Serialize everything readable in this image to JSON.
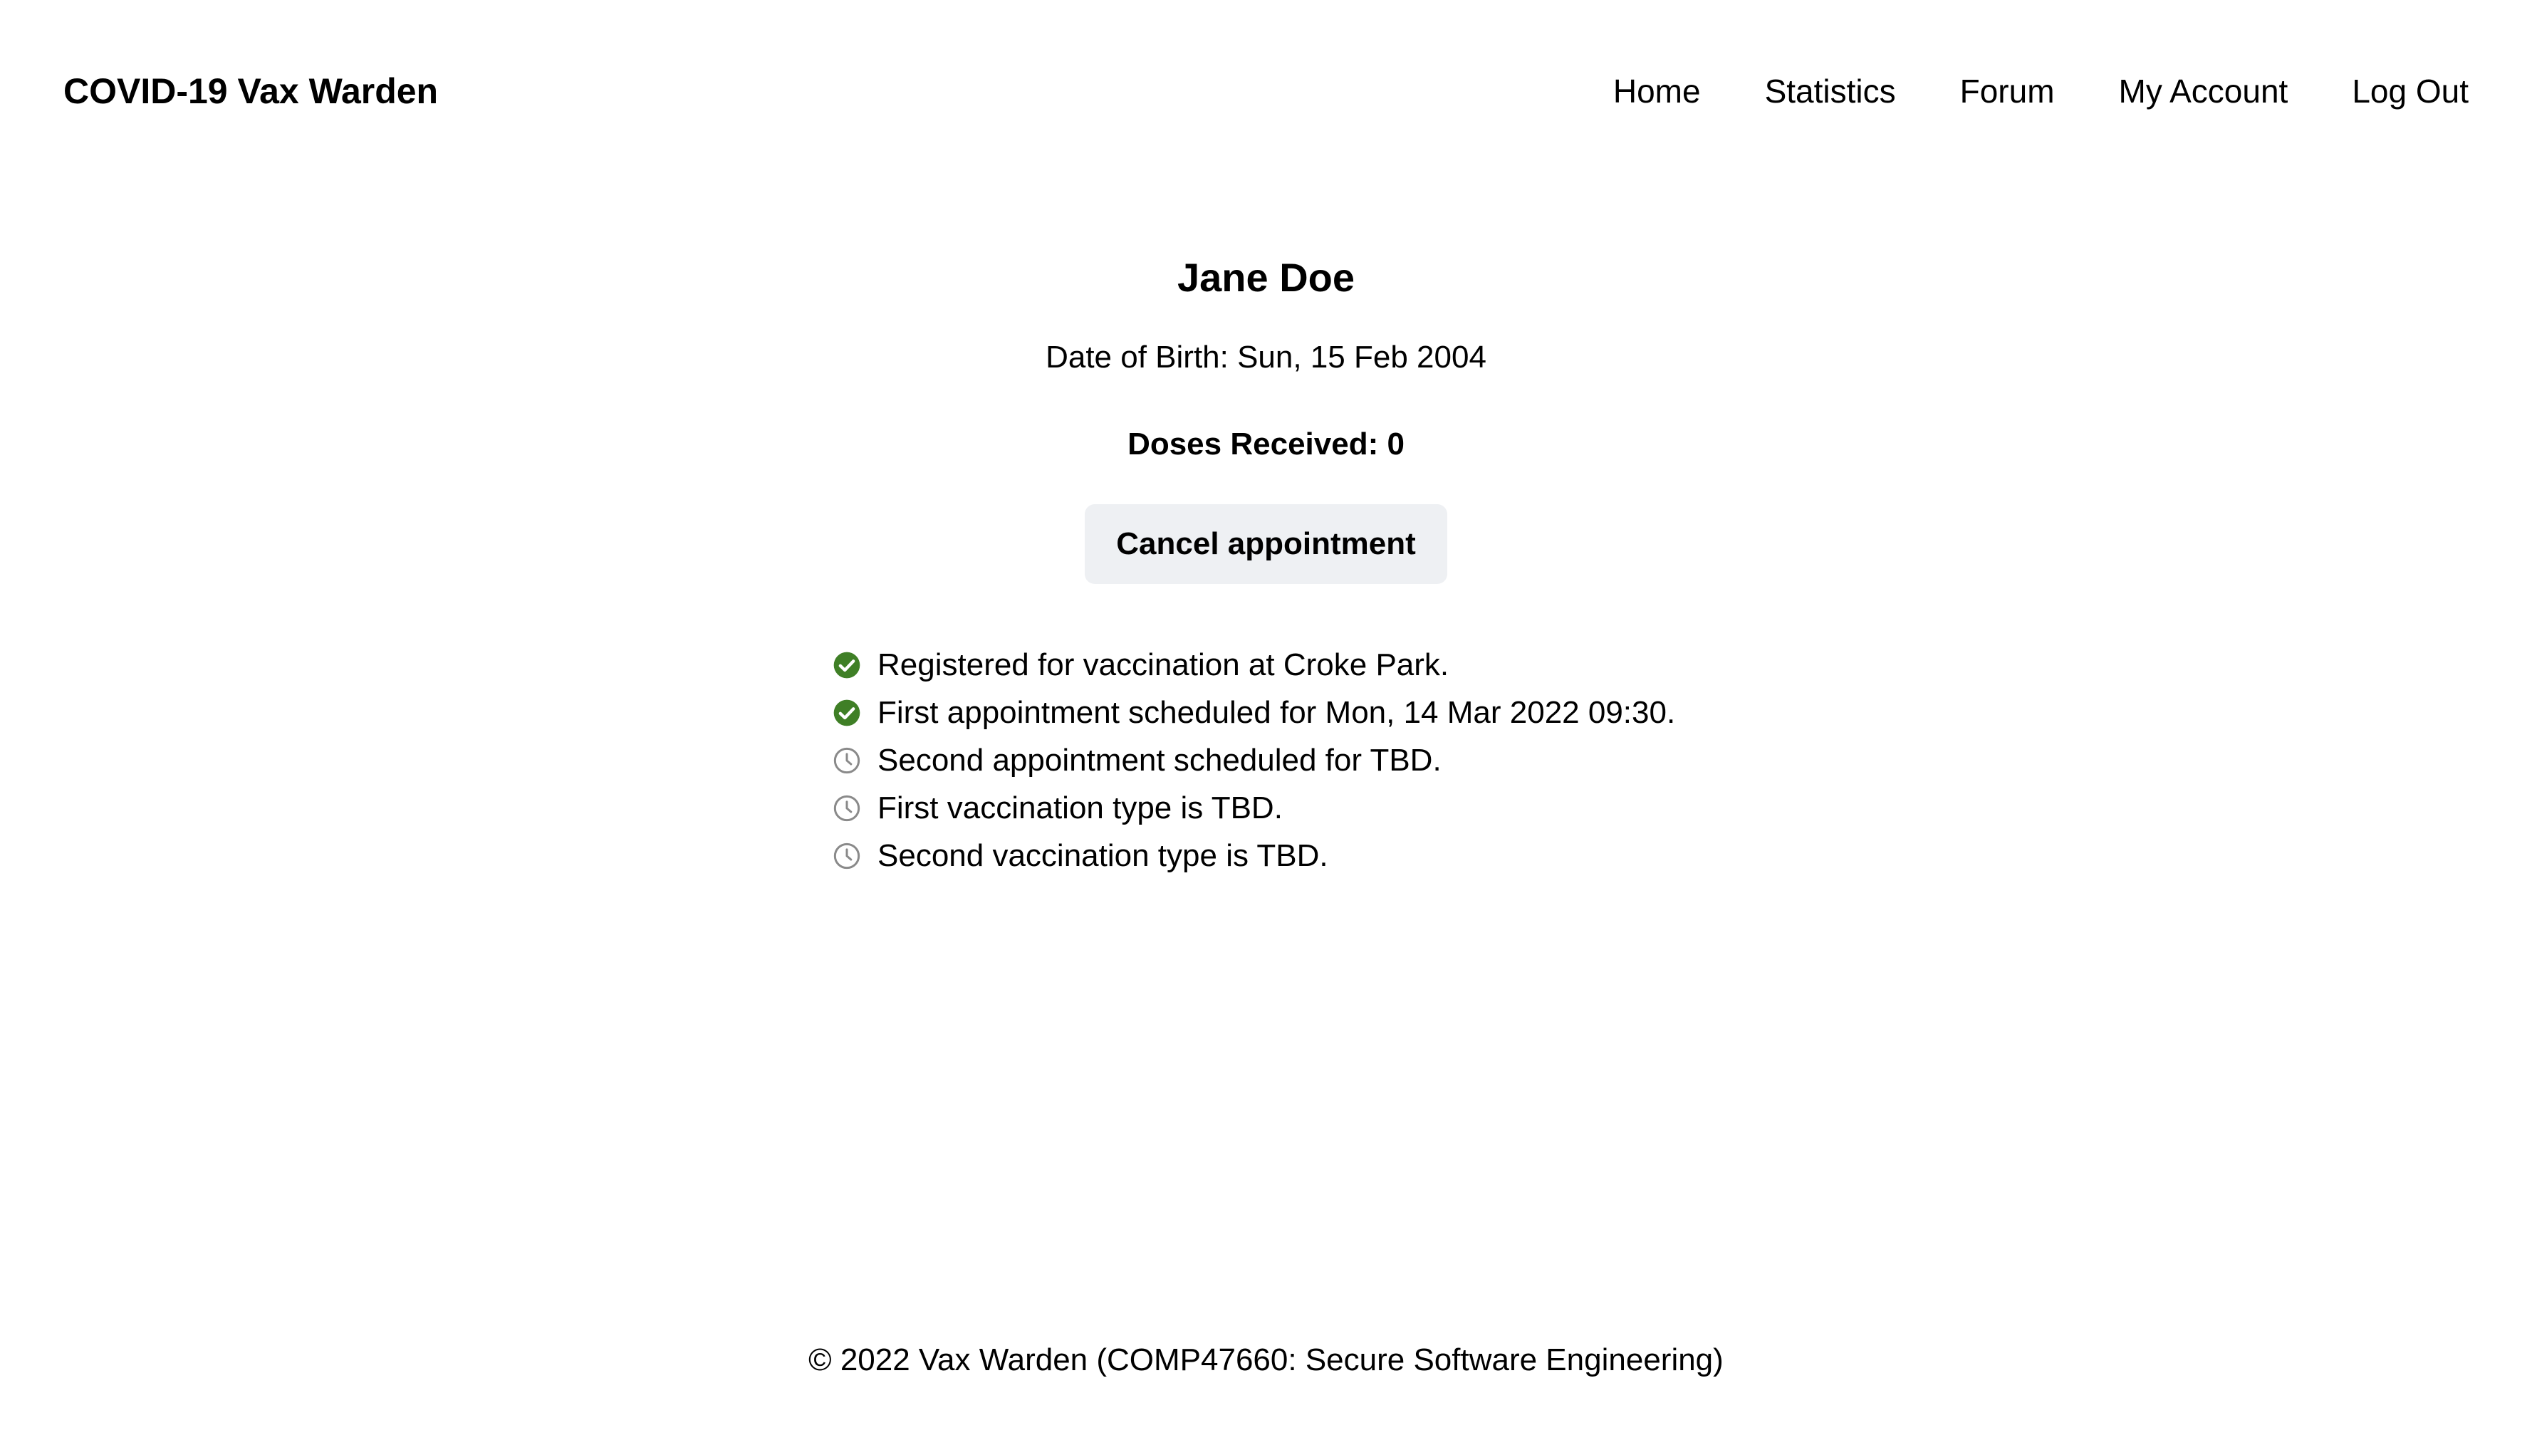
{
  "header": {
    "brand": "COVID-19 Vax Warden",
    "nav": {
      "home": "Home",
      "statistics": "Statistics",
      "forum": "Forum",
      "account": "My Account",
      "logout": "Log Out"
    }
  },
  "profile": {
    "name": "Jane Doe",
    "dob": "Date of Birth: Sun, 15 Feb 2004",
    "doses": "Doses Received: 0",
    "cancel_label": "Cancel appointment"
  },
  "status": {
    "items": [
      {
        "icon": "check-circle-icon",
        "text": "Registered for vaccination at Croke Park."
      },
      {
        "icon": "check-circle-icon",
        "text": "First appointment scheduled for Mon, 14 Mar 2022 09:30."
      },
      {
        "icon": "clock-icon",
        "text": "Second appointment scheduled for TBD."
      },
      {
        "icon": "clock-icon",
        "text": "First vaccination type is TBD."
      },
      {
        "icon": "clock-icon",
        "text": "Second vaccination type is TBD."
      }
    ]
  },
  "footer": {
    "text": "© 2022 Vax Warden (COMP47660: Secure Software Engineering)"
  },
  "colors": {
    "check": "#3f7f26",
    "clock": "#8a8a8a",
    "button_bg": "#eef0f3"
  }
}
